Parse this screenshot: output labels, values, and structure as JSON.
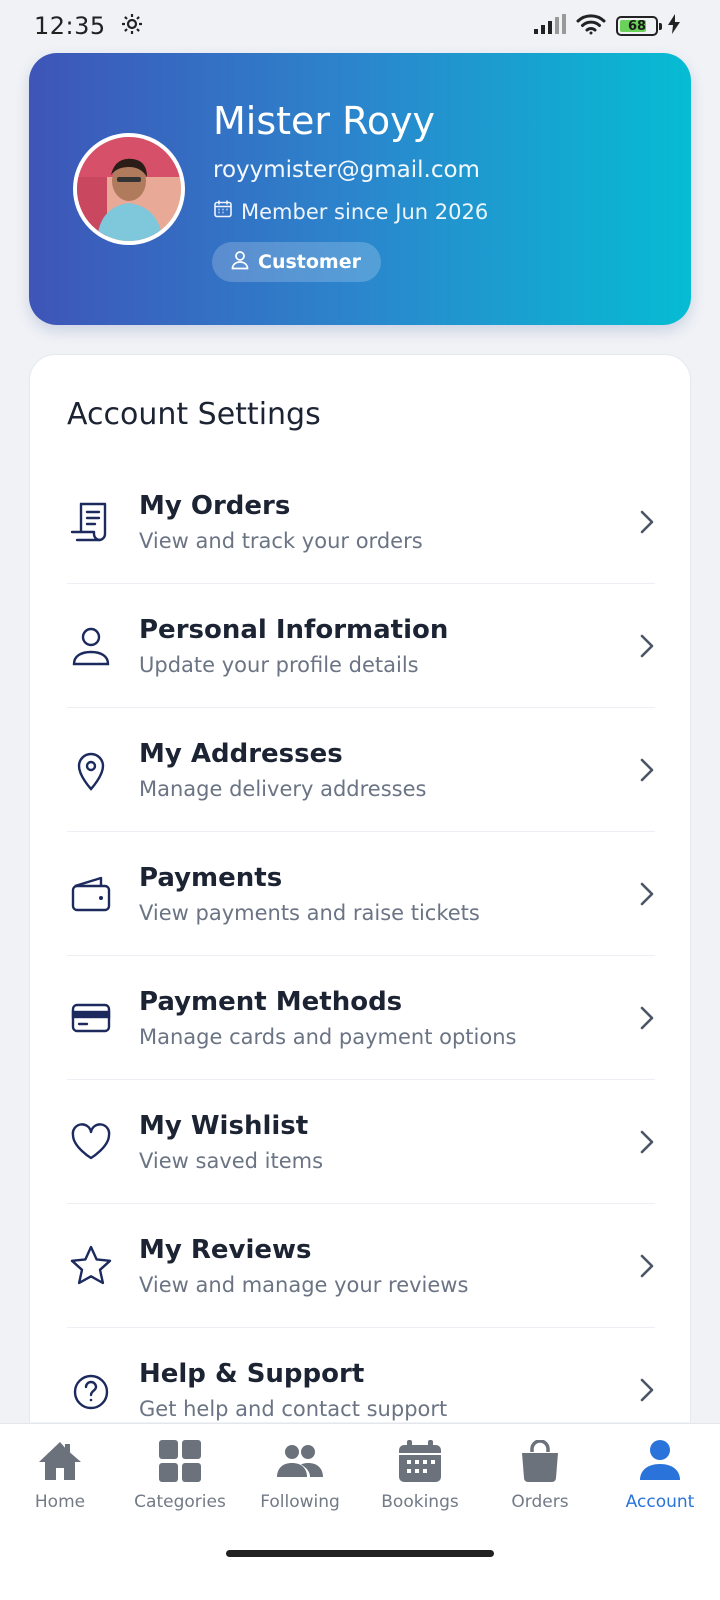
{
  "status_bar": {
    "time": "12:35",
    "battery": "68",
    "battery_level": 0.68
  },
  "profile": {
    "name": "Mister Royy",
    "email": "royymister@gmail.com",
    "member_since": "Member since Jun 2026",
    "role": "Customer"
  },
  "settings": {
    "title": "Account Settings",
    "items": [
      {
        "title": "My Orders",
        "subtitle": "View and track your orders",
        "icon": "receipt-icon"
      },
      {
        "title": "Personal Information",
        "subtitle": "Update your profile details",
        "icon": "user-icon"
      },
      {
        "title": "My Addresses",
        "subtitle": "Manage delivery addresses",
        "icon": "location-pin-icon"
      },
      {
        "title": "Payments",
        "subtitle": "View payments and raise tickets",
        "icon": "wallet-icon"
      },
      {
        "title": "Payment Methods",
        "subtitle": "Manage cards and payment options",
        "icon": "credit-card-icon"
      },
      {
        "title": "My Wishlist",
        "subtitle": "View saved items",
        "icon": "heart-icon"
      },
      {
        "title": "My Reviews",
        "subtitle": "View and manage your reviews",
        "icon": "star-icon"
      },
      {
        "title": "Help & Support",
        "subtitle": "Get help and contact support",
        "icon": "help-circle-icon"
      }
    ]
  },
  "nav": {
    "items": [
      {
        "label": "Home",
        "icon": "home-icon"
      },
      {
        "label": "Categories",
        "icon": "grid-icon"
      },
      {
        "label": "Following",
        "icon": "people-icon"
      },
      {
        "label": "Bookings",
        "icon": "calendar-icon"
      },
      {
        "label": "Orders",
        "icon": "shopping-bag-icon"
      },
      {
        "label": "Account",
        "icon": "account-icon"
      }
    ],
    "active": "Account"
  },
  "colors": {
    "accent": "#2a73db",
    "gradient_start": "#3e55b8",
    "gradient_end": "#06bcd3",
    "icon_navy": "#1c2a5e",
    "battery_green": "#6ad25a"
  }
}
